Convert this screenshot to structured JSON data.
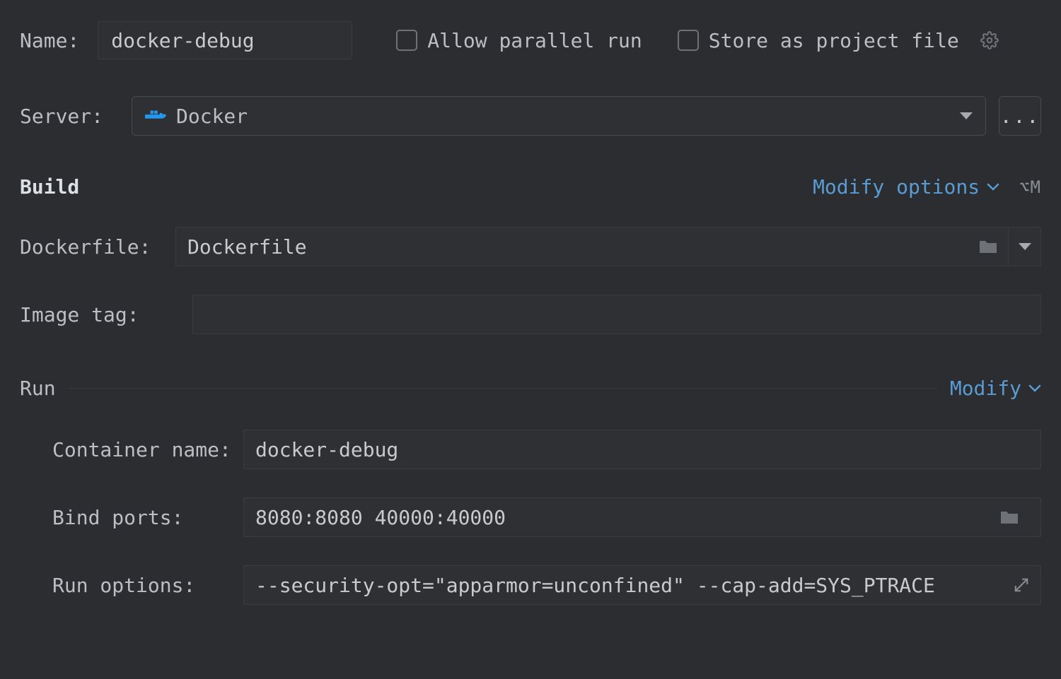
{
  "header": {
    "name_label": "Name:",
    "name_value": "docker-debug",
    "allow_parallel_label": "Allow parallel run",
    "store_project_label": "Store as project file"
  },
  "server": {
    "label": "Server:",
    "selected": "Docker",
    "more": "..."
  },
  "build": {
    "heading": "Build",
    "modify_label": "Modify options",
    "shortcut": "⌥M",
    "dockerfile_label": "Dockerfile:",
    "dockerfile_value": "Dockerfile",
    "imagetag_label": "Image tag:",
    "imagetag_value": ""
  },
  "run": {
    "heading": "Run",
    "modify_label": "Modify",
    "container_label": "Container name:",
    "container_value": "docker-debug",
    "bindports_label": "Bind ports:",
    "bindports_value": "8080:8080 40000:40000",
    "runoptions_label": "Run options:",
    "runoptions_value": "--security-opt=\"apparmor=unconfined\" --cap-add=SYS_PTRACE"
  }
}
